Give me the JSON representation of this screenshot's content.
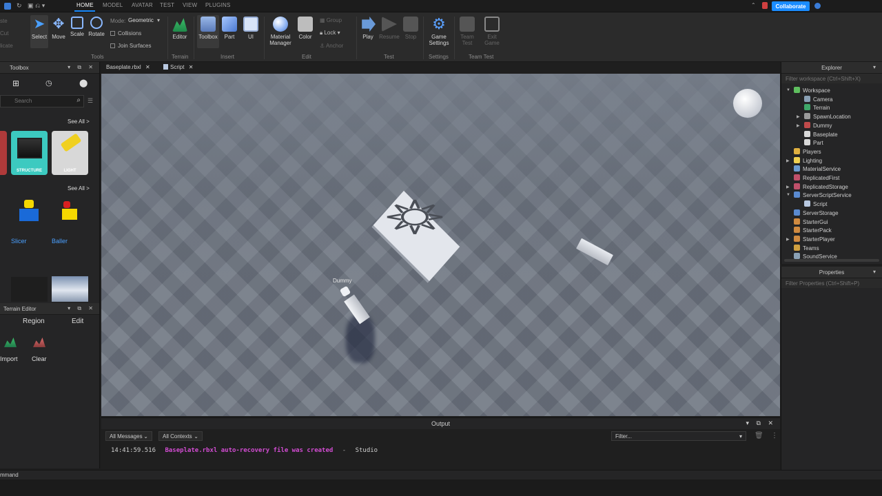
{
  "menubar": {
    "tabs": [
      "HOME",
      "MODEL",
      "AVATAR",
      "TEST",
      "VIEW",
      "PLUGINS"
    ],
    "active_tab": "HOME",
    "collaborate_label": "Collaborate"
  },
  "ribbon": {
    "tools": {
      "buttons": [
        "Select",
        "Move",
        "Scale",
        "Rotate"
      ],
      "mode_label": "Mode:",
      "mode_value": "Geometric",
      "collisions_label": "Collisions",
      "join_surfaces_label": "Join Surfaces",
      "group_label": "Tools"
    },
    "terrain": {
      "editor_label": "Editor",
      "group_label": "Terrain"
    },
    "insert": {
      "toolbox_label": "Toolbox",
      "part_label": "Part",
      "ui_label": "UI",
      "group_label": "Insert"
    },
    "edit": {
      "material_label": "Material",
      "manager_label": "Manager",
      "color_label": "Color",
      "group_btn_label": "Group",
      "lock_label": "Lock",
      "anchor_label": "Anchor",
      "group_label": "Edit"
    },
    "test": {
      "play_label": "Play",
      "resume_label": "Resume",
      "stop_label": "Stop",
      "group_label": "Test"
    },
    "settings": {
      "game_label": "Game",
      "settings_label": "Settings",
      "group_label": "Settings"
    },
    "team_test": {
      "team_label": "Team",
      "test_label": "Test",
      "exit_label": "Exit",
      "game_label": "Game",
      "group_label": "Team Test"
    }
  },
  "toolbox": {
    "title": "Toolbox",
    "search_placeholder": "Search",
    "see_all_1": "See All >",
    "see_all_2": "See All >",
    "items_row1": [
      "STRUCTURE",
      "LIGHT"
    ],
    "items_row2": [
      "Slicer",
      "Baller"
    ]
  },
  "terrain_editor": {
    "title": "Terrain Editor",
    "tabs": [
      "Region",
      "Edit"
    ],
    "actions": [
      "Import",
      "Clear"
    ]
  },
  "doc_tabs": [
    "Baseplate.rbxl",
    "Script"
  ],
  "viewport": {
    "dummy_label": "Dummy"
  },
  "explorer": {
    "title": "Explorer",
    "filter_placeholder": "Filter workspace (Ctrl+Shift+X)",
    "items": [
      {
        "label": "Workspace",
        "indent": 0,
        "color": "#5fbf5f",
        "arrow": "down"
      },
      {
        "label": "Camera",
        "indent": 1,
        "color": "#8aa0b4",
        "arrow": ""
      },
      {
        "label": "Terrain",
        "indent": 1,
        "color": "#3fa86a",
        "arrow": ""
      },
      {
        "label": "SpawnLocation",
        "indent": 1,
        "color": "#9a9a9a",
        "arrow": "right"
      },
      {
        "label": "Dummy",
        "indent": 1,
        "color": "#c04a4a",
        "arrow": "right"
      },
      {
        "label": "Baseplate",
        "indent": 1,
        "color": "#d8d8d8",
        "arrow": ""
      },
      {
        "label": "Part",
        "indent": 1,
        "color": "#d8d8d8",
        "arrow": ""
      },
      {
        "label": "Players",
        "indent": 0,
        "color": "#e0b040",
        "arrow": ""
      },
      {
        "label": "Lighting",
        "indent": 0,
        "color": "#f0d050",
        "arrow": "right"
      },
      {
        "label": "MaterialService",
        "indent": 0,
        "color": "#6a9ad0",
        "arrow": ""
      },
      {
        "label": "ReplicatedFirst",
        "indent": 0,
        "color": "#c0506a",
        "arrow": ""
      },
      {
        "label": "ReplicatedStorage",
        "indent": 0,
        "color": "#c0506a",
        "arrow": "right"
      },
      {
        "label": "ServerScriptService",
        "indent": 0,
        "color": "#5a8ad0",
        "arrow": "down"
      },
      {
        "label": "Script",
        "indent": 1,
        "color": "#b8c8e0",
        "arrow": ""
      },
      {
        "label": "ServerStorage",
        "indent": 0,
        "color": "#5a8ad0",
        "arrow": ""
      },
      {
        "label": "StarterGui",
        "indent": 0,
        "color": "#d08a40",
        "arrow": ""
      },
      {
        "label": "StarterPack",
        "indent": 0,
        "color": "#d08a40",
        "arrow": ""
      },
      {
        "label": "StarterPlayer",
        "indent": 0,
        "color": "#d08a40",
        "arrow": "right"
      },
      {
        "label": "Teams",
        "indent": 0,
        "color": "#d0a040",
        "arrow": ""
      },
      {
        "label": "SoundService",
        "indent": 0,
        "color": "#8aa0b4",
        "arrow": ""
      }
    ]
  },
  "properties": {
    "title": "Properties",
    "filter_placeholder": "Filter Properties (Ctrl+Shift+P)"
  },
  "output": {
    "title": "Output",
    "messages_filter": "All Messages",
    "contexts_filter": "All Contexts",
    "filter_placeholder": "Filter...",
    "log": {
      "timestamp": "14:41:59.516",
      "message": "Baseplate.rbxl auto-recovery file was created",
      "separator": "-",
      "source": "Studio"
    }
  },
  "command_bar": {
    "label": "mmand"
  },
  "colors": {
    "accent": "#1a8cff",
    "highlight_text": "#d24cd2",
    "panel_bg": "#252526"
  }
}
